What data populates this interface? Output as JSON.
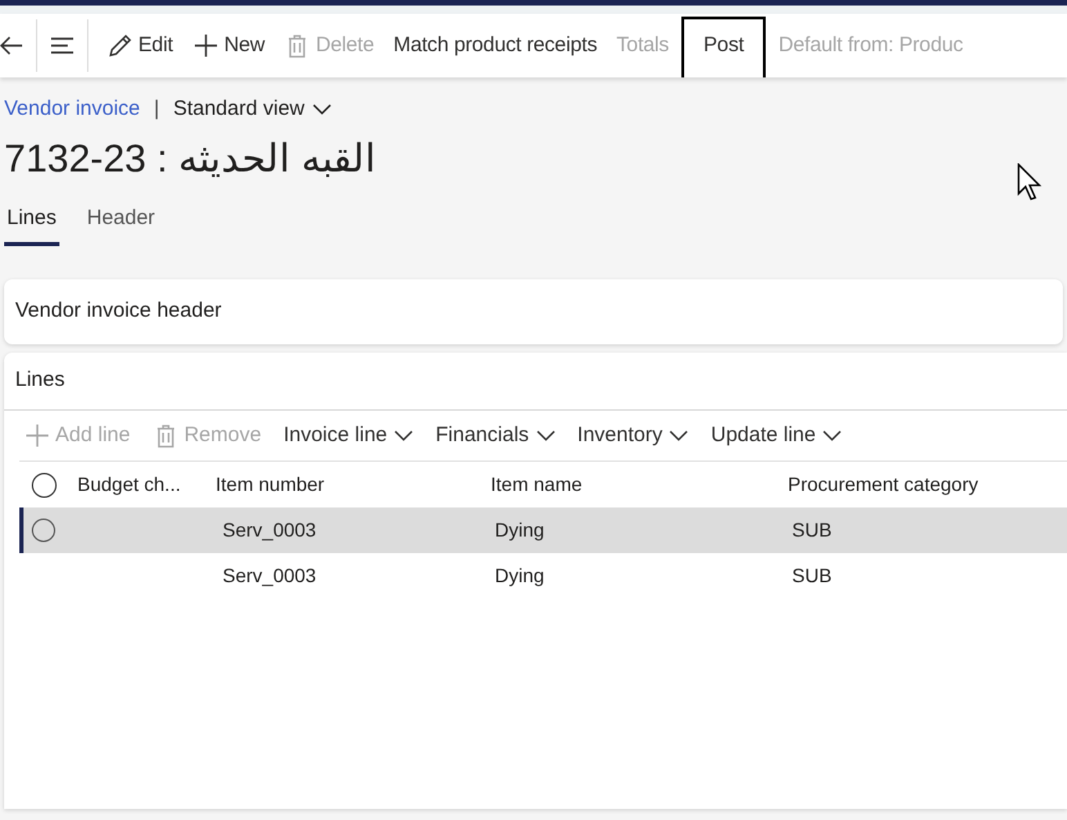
{
  "toolbar": {
    "items": [
      {
        "kind": "back",
        "disabled": false
      },
      {
        "kind": "menu",
        "disabled": false
      },
      {
        "kind": "edit",
        "label": "Edit",
        "disabled": false
      },
      {
        "kind": "new",
        "label": "New",
        "disabled": false
      },
      {
        "kind": "delete",
        "label": "Delete",
        "disabled": true
      },
      {
        "kind": "text",
        "label": "Match product receipts",
        "disabled": false
      },
      {
        "kind": "text",
        "label": "Totals",
        "disabled": true
      },
      {
        "kind": "text",
        "label": "Post",
        "disabled": false,
        "highlighted": true
      },
      {
        "kind": "text",
        "label": "Default from: Produc",
        "disabled": true
      }
    ]
  },
  "breadcrumb": {
    "link": "Vendor invoice",
    "separator": "|",
    "view": "Standard view"
  },
  "title": "7132-23 : القبه الحديثه",
  "tabs": [
    {
      "label": "Lines",
      "selected": true
    },
    {
      "label": "Header",
      "selected": false
    }
  ],
  "header_section": {
    "title": "Vendor invoice header"
  },
  "lines": {
    "title": "Lines",
    "actions": [
      {
        "kind": "add",
        "label": "Add line",
        "disabled": true
      },
      {
        "kind": "remove",
        "label": "Remove",
        "disabled": true
      },
      {
        "kind": "dropdown",
        "label": "Invoice line",
        "disabled": false
      },
      {
        "kind": "dropdown",
        "label": "Financials",
        "disabled": false
      },
      {
        "kind": "dropdown",
        "label": "Inventory",
        "disabled": false
      },
      {
        "kind": "dropdown",
        "label": "Update line",
        "disabled": false
      }
    ],
    "table": {
      "all_selected": false,
      "columns": [
        "Budget ch...",
        "Item number",
        "Item name",
        "Procurement category"
      ],
      "rows": [
        {
          "selected": true,
          "cells": [
            "",
            "Serv_0003",
            "Dying",
            "SUB"
          ]
        },
        {
          "selected": false,
          "cells": [
            "",
            "Serv_0003",
            "Dying",
            "SUB"
          ]
        }
      ]
    }
  }
}
